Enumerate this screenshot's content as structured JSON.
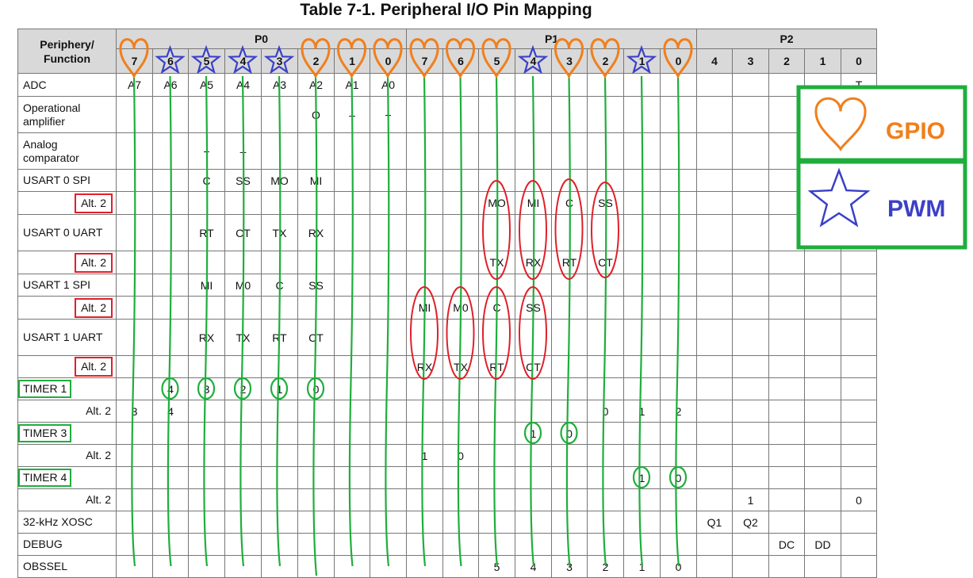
{
  "title": "Table 7-1. Peripheral I/O Pin Mapping",
  "header": {
    "function_label": "Periphery/\nFunction",
    "ports": [
      "P0",
      "P1",
      "P2"
    ],
    "p0_pins": [
      "7",
      "6",
      "5",
      "4",
      "3",
      "2",
      "1",
      "0"
    ],
    "p1_pins": [
      "7",
      "6",
      "5",
      "4",
      "3",
      "2",
      "1",
      "0"
    ],
    "p2_pins": [
      "4",
      "3",
      "2",
      "1",
      "0"
    ]
  },
  "rows": [
    {
      "label": "ADC",
      "kind": "main",
      "cells": [
        "A7",
        "A6",
        "A5",
        "A4",
        "A3",
        "A2",
        "A1",
        "A0",
        "",
        "",
        "",
        "",
        "",
        "",
        "",
        "",
        "",
        "",
        "",
        "",
        "T"
      ]
    },
    {
      "label": "Operational amplifier",
      "kind": "main",
      "cells": [
        "",
        "",
        "",
        "",
        "",
        "O",
        "–",
        "+",
        "",
        "",
        "",
        "",
        "",
        "",
        "",
        "",
        "",
        "",
        "",
        "",
        ""
      ]
    },
    {
      "label": "Analog comparator",
      "kind": "main",
      "cells": [
        "",
        "",
        "+",
        "–",
        "",
        "",
        "",
        "",
        "",
        "",
        "",
        "",
        "",
        "",
        "",
        "",
        "",
        "",
        "",
        "",
        ""
      ]
    },
    {
      "label": "USART 0 SPI",
      "kind": "main",
      "cells": [
        "",
        "",
        "C",
        "SS",
        "MO",
        "MI",
        "",
        "",
        "",
        "",
        "",
        "",
        "",
        "",
        "",
        "",
        "",
        "",
        "",
        "",
        ""
      ]
    },
    {
      "label": "Alt. 2",
      "kind": "alt",
      "boxed": "red",
      "cells": [
        "",
        "",
        "",
        "",
        "",
        "",
        "",
        "",
        "",
        "",
        "MO",
        "MI",
        "C",
        "SS",
        "",
        "",
        "",
        "",
        "",
        "",
        ""
      ]
    },
    {
      "label": "USART 0 UART",
      "kind": "main",
      "cells": [
        "",
        "",
        "RT",
        "CT",
        "TX",
        "RX",
        "",
        "",
        "",
        "",
        "",
        "",
        "",
        "",
        "",
        "",
        "",
        "",
        "",
        "",
        ""
      ]
    },
    {
      "label": "Alt. 2",
      "kind": "alt",
      "boxed": "red",
      "cells": [
        "",
        "",
        "",
        "",
        "",
        "",
        "",
        "",
        "",
        "",
        "TX",
        "RX",
        "RT",
        "CT",
        "",
        "",
        "",
        "",
        "",
        "",
        ""
      ]
    },
    {
      "label": "USART 1 SPI",
      "kind": "main",
      "cells": [
        "",
        "",
        "MI",
        "M0",
        "C",
        "SS",
        "",
        "",
        "",
        "",
        "",
        "",
        "",
        "",
        "",
        "",
        "",
        "",
        "",
        "",
        ""
      ]
    },
    {
      "label": "Alt. 2",
      "kind": "alt",
      "boxed": "red",
      "cells": [
        "",
        "",
        "",
        "",
        "",
        "",
        "",
        "",
        "MI",
        "M0",
        "C",
        "SS",
        "",
        "",
        "",
        "",
        "",
        "",
        "",
        "",
        ""
      ]
    },
    {
      "label": "USART 1 UART",
      "kind": "main",
      "cells": [
        "",
        "",
        "RX",
        "TX",
        "RT",
        "CT",
        "",
        "",
        "",
        "",
        "",
        "",
        "",
        "",
        "",
        "",
        "",
        "",
        "",
        "",
        ""
      ]
    },
    {
      "label": "Alt. 2",
      "kind": "alt",
      "boxed": "red",
      "cells": [
        "",
        "",
        "",
        "",
        "",
        "",
        "",
        "",
        "RX",
        "TX",
        "RT",
        "CT",
        "",
        "",
        "",
        "",
        "",
        "",
        "",
        "",
        ""
      ]
    },
    {
      "label": "TIMER 1",
      "kind": "main",
      "boxed": "green",
      "cells": [
        "",
        "4",
        "3",
        "2",
        "1",
        "0",
        "",
        "",
        "",
        "",
        "",
        "",
        "",
        "",
        "",
        "",
        "",
        "",
        "",
        "",
        ""
      ]
    },
    {
      "label": "Alt. 2",
      "kind": "alt",
      "cells": [
        "3",
        "4",
        "",
        "",
        "",
        "",
        "",
        "",
        "",
        "",
        "",
        "",
        "",
        "0",
        "1",
        "2",
        "",
        "",
        "",
        "",
        ""
      ]
    },
    {
      "label": "TIMER 3",
      "kind": "main",
      "boxed": "green",
      "cells": [
        "",
        "",
        "",
        "",
        "",
        "",
        "",
        "",
        "",
        "",
        "",
        "1",
        "0",
        "",
        "",
        "",
        "",
        "",
        "",
        "",
        ""
      ]
    },
    {
      "label": "Alt. 2",
      "kind": "alt",
      "cells": [
        "",
        "",
        "",
        "",
        "",
        "",
        "",
        "",
        "1",
        "0",
        "",
        "",
        "",
        "",
        "",
        "",
        "",
        "",
        "",
        "",
        ""
      ]
    },
    {
      "label": "TIMER 4",
      "kind": "main",
      "boxed": "green",
      "cells": [
        "",
        "",
        "",
        "",
        "",
        "",
        "",
        "",
        "",
        "",
        "",
        "",
        "",
        "",
        "1",
        "0",
        "",
        "",
        "",
        "",
        ""
      ]
    },
    {
      "label": "Alt. 2",
      "kind": "alt",
      "cells": [
        "",
        "",
        "",
        "",
        "",
        "",
        "",
        "",
        "",
        "",
        "",
        "",
        "",
        "",
        "",
        "",
        "",
        "1",
        "",
        "",
        "0"
      ]
    },
    {
      "label": "32-kHz XOSC",
      "kind": "main",
      "cells": [
        "",
        "",
        "",
        "",
        "",
        "",
        "",
        "",
        "",
        "",
        "",
        "",
        "",
        "",
        "",
        "",
        "Q1",
        "Q2",
        "",
        "",
        ""
      ]
    },
    {
      "label": "DEBUG",
      "kind": "main",
      "cells": [
        "",
        "",
        "",
        "",
        "",
        "",
        "",
        "",
        "",
        "",
        "",
        "",
        "",
        "",
        "",
        "",
        "",
        "",
        "DC",
        "DD",
        ""
      ]
    },
    {
      "label": "OBSSEL",
      "kind": "main",
      "cells": [
        "",
        "",
        "",
        "",
        "",
        "",
        "",
        "",
        "",
        "",
        "5",
        "4",
        "3",
        "2",
        "1",
        "0",
        "",
        "",
        "",
        "",
        ""
      ]
    }
  ],
  "legend": {
    "gpio_label": "GPIO",
    "pwm_label": "PWM",
    "gpio_icon": "heart-icon",
    "pwm_icon": "star-icon"
  },
  "annotations": {
    "gpio_pins": [
      "P0.7",
      "P0.2",
      "P0.1",
      "P0.0",
      "P1.7",
      "P1.6",
      "P1.5",
      "P1.3",
      "P1.2",
      "P1.0"
    ],
    "pwm_pins": [
      "P0.6",
      "P0.5",
      "P0.4",
      "P0.3",
      "P1.4",
      "P1.1"
    ],
    "colors": {
      "gpio": "#f07f1c",
      "pwm": "#3b40c8",
      "timer": "#1fae3c",
      "alt_box": "#e0202a",
      "legend_border": "#1fae3c",
      "header_bg": "#d9d9d9"
    }
  }
}
